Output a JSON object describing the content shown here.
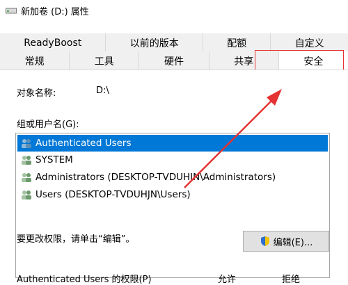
{
  "window": {
    "title": "新加卷 (D:) 属性"
  },
  "tabs": {
    "back_row": [
      "ReadyBoost",
      "以前的版本",
      "配额",
      "自定义"
    ],
    "front_row": [
      "常规",
      "工具",
      "硬件",
      "共享",
      "安全"
    ],
    "active": "安全"
  },
  "object": {
    "label": "对象名称:",
    "value": "D:\\"
  },
  "groups": {
    "label": "组或用户名(G):",
    "items": [
      "Authenticated Users",
      "SYSTEM",
      "Administrators (DESKTOP-TVDUHJN\\Administrators)",
      "Users (DESKTOP-TVDUHJN\\Users)"
    ],
    "selected_index": 0
  },
  "edit": {
    "hint": "要更改权限，请单击“编辑”。",
    "button_label": "编辑(E)..."
  },
  "permissions": {
    "label": "Authenticated Users 的权限(P)",
    "allow": "允许",
    "deny": "拒绝"
  },
  "colors": {
    "selection": "#0078d7",
    "annotation": "#e53232"
  }
}
